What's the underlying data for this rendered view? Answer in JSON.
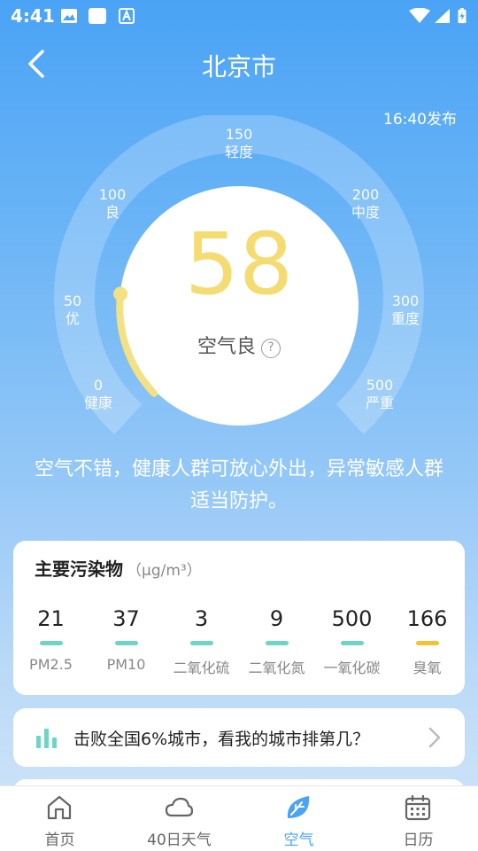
{
  "status_bar": {
    "time": "4:41"
  },
  "header": {
    "title": "北京市",
    "publish_time": "16:40发布"
  },
  "gauge": {
    "labels": [
      {
        "value": "0",
        "level": "健康"
      },
      {
        "value": "50",
        "level": "优"
      },
      {
        "value": "100",
        "level": "良"
      },
      {
        "value": "150",
        "level": "轻度"
      },
      {
        "value": "200",
        "level": "中度"
      },
      {
        "value": "300",
        "level": "重度"
      },
      {
        "value": "500",
        "level": "严重"
      }
    ],
    "aqi": "58",
    "status": "空气良",
    "help": "?",
    "accent_color": "#f4dc73"
  },
  "advice": "空气不错，健康人群可放心外出，异常敏感人群适当防护。",
  "pollutants": {
    "title": "主要污染物",
    "unit": "（μg/m³）",
    "items": [
      {
        "name": "PM2.5",
        "value": "21",
        "color": "#6dd5c4"
      },
      {
        "name": "PM10",
        "value": "37",
        "color": "#6dd5c4"
      },
      {
        "name": "二氧化硫",
        "value": "3",
        "color": "#6dd5c4"
      },
      {
        "name": "二氧化氮",
        "value": "9",
        "color": "#6dd5c4"
      },
      {
        "name": "一氧化碳",
        "value": "500",
        "color": "#6dd5c4"
      },
      {
        "name": "臭氧",
        "value": "166",
        "color": "#f1c232"
      }
    ]
  },
  "rank": {
    "text": "击败全国6%城市，看我的城市排第几？",
    "icon": "bar-chart-icon"
  },
  "nav": {
    "items": [
      {
        "label": "首页",
        "icon": "home-icon"
      },
      {
        "label": "40日天气",
        "icon": "cloud-icon"
      },
      {
        "label": "空气",
        "icon": "leaf-icon",
        "active": true
      },
      {
        "label": "日历",
        "icon": "calendar-icon"
      }
    ],
    "active_color": "#4aa3f5"
  }
}
